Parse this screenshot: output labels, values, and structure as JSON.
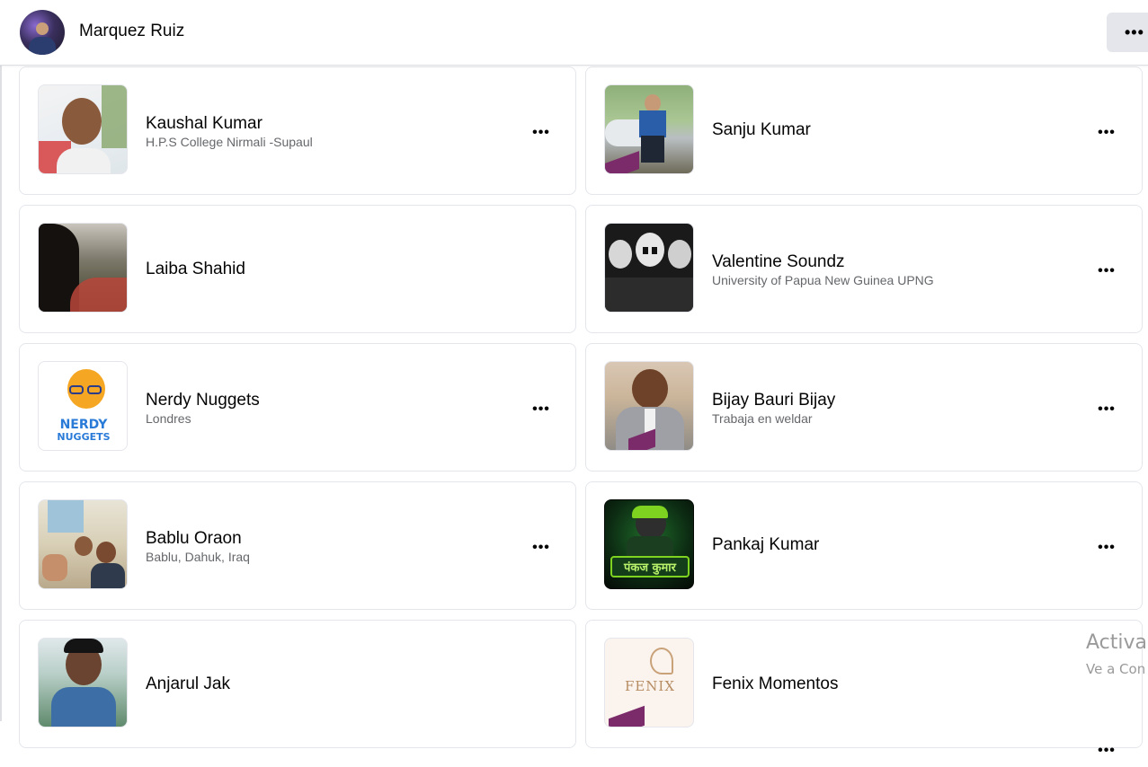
{
  "header": {
    "profile_name": "Marquez Ruiz",
    "more_icon": "ellipsis-icon"
  },
  "friends": [
    {
      "name": "Kaushal Kumar",
      "subtitle": "H.P.S College Nirmali -Supaul"
    },
    {
      "name": "Sanju Kumar",
      "subtitle": ""
    },
    {
      "name": "Laiba Shahid",
      "subtitle": ""
    },
    {
      "name": "Valentine Soundz",
      "subtitle": "University of Papua New Guinea UPNG"
    },
    {
      "name": "Nerdy Nuggets",
      "subtitle": "Londres"
    },
    {
      "name": "Bijay Bauri Bijay",
      "subtitle": "Trabaja en weldar"
    },
    {
      "name": "Bablu Oraon",
      "subtitle": "Bablu, Dahuk, Iraq"
    },
    {
      "name": "Pankaj Kumar",
      "subtitle": ""
    },
    {
      "name": "Anjarul Jak",
      "subtitle": ""
    },
    {
      "name": "Fenix Momentos",
      "subtitle": ""
    }
  ],
  "photo_text": {
    "nerdy_line1": "NERDY",
    "nerdy_line2": "NUGGETS",
    "pankaj_banner": "पंकज कुमार",
    "fenix_logo": "FENIX"
  },
  "card_more_label": "•••",
  "watermark": {
    "line1": "Activa",
    "line2": "Ve a Con"
  }
}
